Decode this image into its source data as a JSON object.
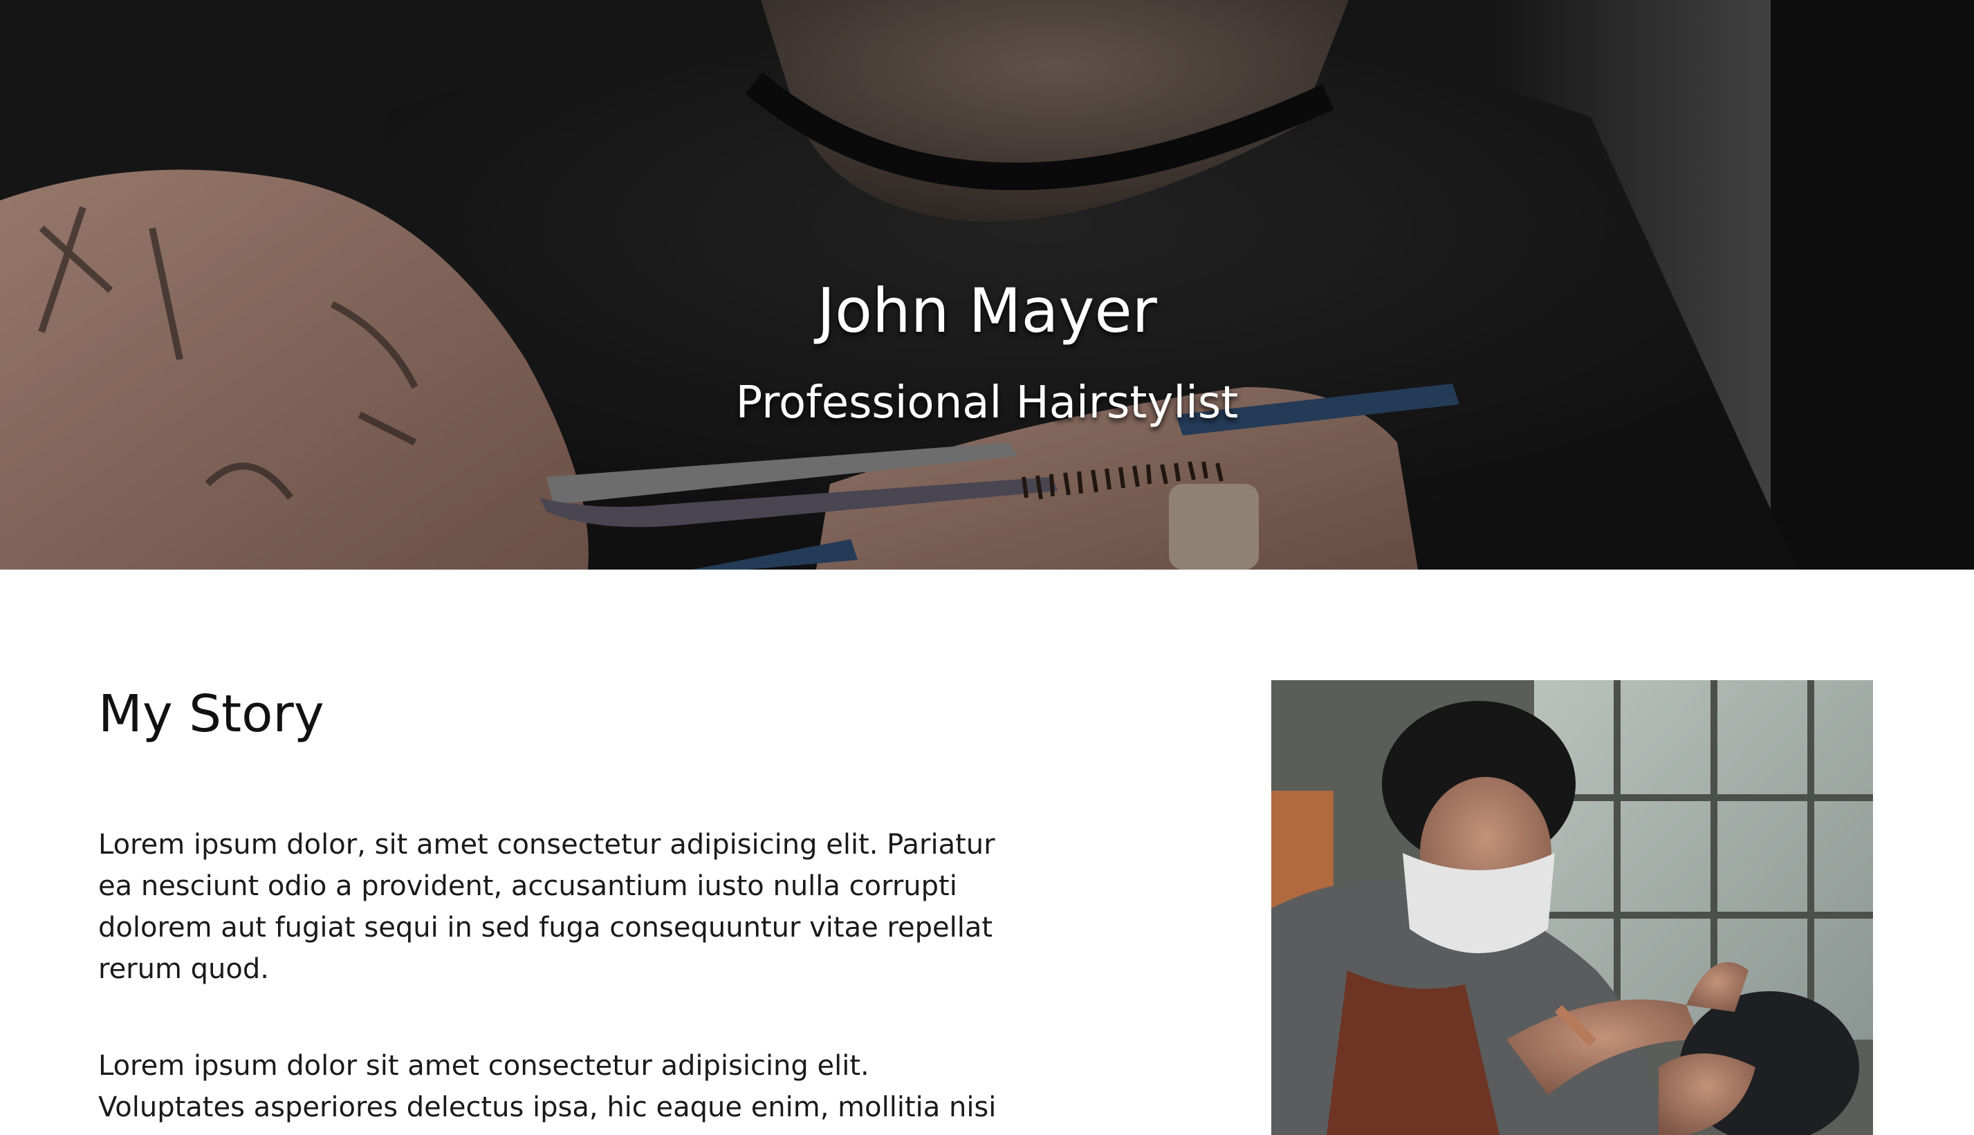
{
  "hero": {
    "title": "John Mayer",
    "subtitle": "Professional Hairstylist",
    "image": "barber-cutting-hair-with-scissors-photo"
  },
  "story": {
    "heading": "My Story",
    "paragraphs": [
      "Lorem ipsum dolor, sit amet consectetur adipisicing elit. Pariatur ea nesciunt odio a provident, accusantium iusto nulla corrupti dolorem aut fugiat sequi in sed fuga consequuntur vitae repellat rerum quod.",
      "Lorem ipsum dolor sit amet consectetur adipisicing elit. Voluptates asperiores delectus ipsa, hic eaque enim, mollitia nisi"
    ],
    "image": "masked-barber-shaving-client-photo"
  },
  "colors": {
    "text": "#111111",
    "hero_text": "#ffffff",
    "background": "#ffffff"
  }
}
